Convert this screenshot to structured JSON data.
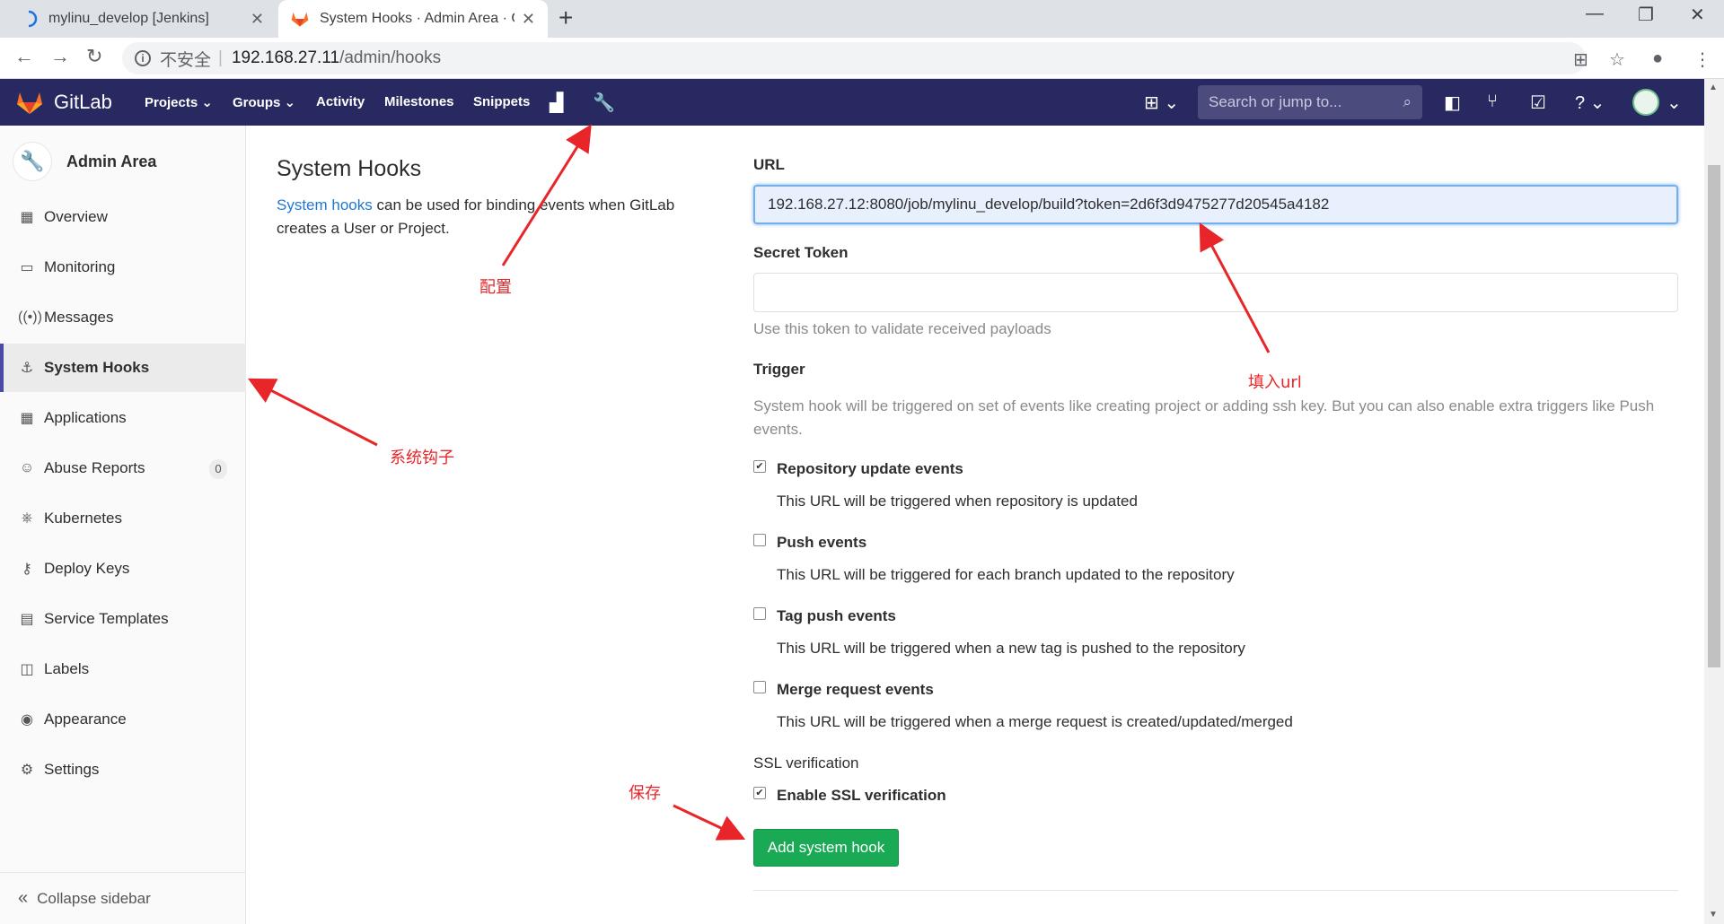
{
  "browser": {
    "tabs": [
      {
        "title": "mylinu_develop [Jenkins]",
        "active": false
      },
      {
        "title": "System Hooks · Admin Area · GitLab",
        "active": true
      }
    ],
    "new_tab_icon": "plus-icon",
    "address": {
      "security_label": "不安全",
      "separator": "|",
      "host": "192.168.27.11",
      "path": "/admin/hooks"
    }
  },
  "gitlab_nav": {
    "brand": "GitLab",
    "links": [
      "Projects",
      "Groups",
      "Activity",
      "Milestones",
      "Snippets"
    ],
    "search_placeholder": "Search or jump to..."
  },
  "sidebar": {
    "title": "Admin Area",
    "items": [
      {
        "label": "Overview",
        "icon": "overview-icon"
      },
      {
        "label": "Monitoring",
        "icon": "monitor-icon"
      },
      {
        "label": "Messages",
        "icon": "broadcast-icon"
      },
      {
        "label": "System Hooks",
        "icon": "hook-icon",
        "active": true
      },
      {
        "label": "Applications",
        "icon": "grid-icon"
      },
      {
        "label": "Abuse Reports",
        "icon": "smiley-icon",
        "badge": "0"
      },
      {
        "label": "Kubernetes",
        "icon": "kubernetes-icon"
      },
      {
        "label": "Deploy Keys",
        "icon": "key-icon"
      },
      {
        "label": "Service Templates",
        "icon": "template-icon"
      },
      {
        "label": "Labels",
        "icon": "label-icon"
      },
      {
        "label": "Appearance",
        "icon": "palette-icon"
      },
      {
        "label": "Settings",
        "icon": "gear-icon"
      }
    ],
    "collapse_label": "Collapse sidebar"
  },
  "page": {
    "title": "System Hooks",
    "desc_link": "System hooks",
    "desc_rest": " can be used for binding events when GitLab creates a User or Project."
  },
  "form": {
    "url_label": "URL",
    "url_value": "192.168.27.12:8080/job/mylinu_develop/build?token=2d6f3d9475277d20545a4182",
    "secret_label": "Secret Token",
    "secret_value": "",
    "secret_help": "Use this token to validate received payloads",
    "trigger_label": "Trigger",
    "trigger_help": "System hook will be triggered on set of events like creating project or adding ssh key. But you can also enable extra triggers like Push events.",
    "triggers": [
      {
        "label": "Repository update events",
        "desc": "This URL will be triggered when repository is updated",
        "checked": true
      },
      {
        "label": "Push events",
        "desc": "This URL will be triggered for each branch updated to the repository",
        "checked": false
      },
      {
        "label": "Tag push events",
        "desc": "This URL will be triggered when a new tag is pushed to the repository",
        "checked": false
      },
      {
        "label": "Merge request events",
        "desc": "This URL will be triggered when a merge request is created/updated/merged",
        "checked": false
      }
    ],
    "ssl_label": "SSL verification",
    "ssl_checkbox_label": "Enable SSL verification",
    "ssl_checked": true,
    "submit_label": "Add system hook"
  },
  "annotations": {
    "config": "配置",
    "fill_url": "填入url",
    "system_hook": "系统钩子",
    "save": "保存",
    "color": "#e8262a"
  }
}
